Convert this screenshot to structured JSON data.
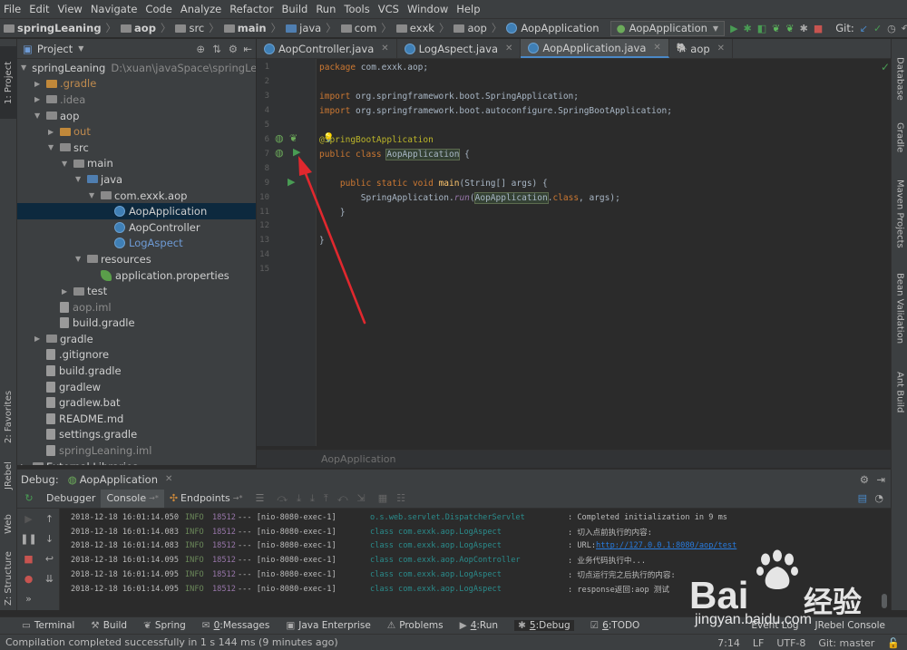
{
  "menu": [
    "File",
    "Edit",
    "View",
    "Navigate",
    "Code",
    "Analyze",
    "Refactor",
    "Build",
    "Run",
    "Tools",
    "VCS",
    "Window",
    "Help"
  ],
  "nav": {
    "crumbs": [
      "springLeaning",
      "aop",
      "src",
      "main",
      "java",
      "com",
      "exxk",
      "aop",
      "AopApplication"
    ],
    "run_config": "AopApplication",
    "git_label": "Git:"
  },
  "left_strip": {
    "project": "1: Project",
    "favorites": "2: Favorites",
    "jrebel": "JRebel",
    "web": "Web",
    "structure": "Z: Structure"
  },
  "right_strip": {
    "database": "Database",
    "gradle": "Gradle",
    "maven": "Maven Projects",
    "bean": "Bean Validation",
    "ant": "Ant Build"
  },
  "project": {
    "title": "Project",
    "tree": [
      {
        "label": "springLeaning",
        "hint": "D:\\xuan\\javaSpace\\springLeaning",
        "depth": 0,
        "arrow": "▼",
        "style": "normal",
        "icon": "folder"
      },
      {
        "label": ".gradle",
        "depth": 1,
        "arrow": "▶",
        "style": "orange",
        "icon": "folder-orange"
      },
      {
        "label": ".idea",
        "depth": 1,
        "arrow": "▶",
        "style": "gray",
        "icon": "folder"
      },
      {
        "label": "aop",
        "depth": 1,
        "arrow": "▼",
        "style": "normal",
        "icon": "folder"
      },
      {
        "label": "out",
        "depth": 2,
        "arrow": "▶",
        "style": "orange",
        "icon": "folder-orange"
      },
      {
        "label": "src",
        "depth": 2,
        "arrow": "▼",
        "style": "normal",
        "icon": "folder"
      },
      {
        "label": "main",
        "depth": 3,
        "arrow": "▼",
        "style": "normal",
        "icon": "folder"
      },
      {
        "label": "java",
        "depth": 4,
        "arrow": "▼",
        "style": "normal",
        "icon": "folder-blue"
      },
      {
        "label": "com.exxk.aop",
        "depth": 5,
        "arrow": "▼",
        "style": "normal",
        "icon": "folder"
      },
      {
        "label": "AopApplication",
        "depth": 6,
        "arrow": "",
        "style": "normal",
        "icon": "class",
        "selected": true
      },
      {
        "label": "AopController",
        "depth": 6,
        "arrow": "",
        "style": "normal",
        "icon": "class"
      },
      {
        "label": "LogAspect",
        "depth": 6,
        "arrow": "",
        "style": "blue",
        "icon": "class"
      },
      {
        "label": "resources",
        "depth": 4,
        "arrow": "▼",
        "style": "normal",
        "icon": "folder"
      },
      {
        "label": "application.properties",
        "depth": 5,
        "arrow": "",
        "style": "normal",
        "icon": "leaf"
      },
      {
        "label": "test",
        "depth": 3,
        "arrow": "▶",
        "style": "normal",
        "icon": "folder"
      },
      {
        "label": "aop.iml",
        "depth": 2,
        "arrow": "",
        "style": "gray",
        "icon": "file"
      },
      {
        "label": "build.gradle",
        "depth": 2,
        "arrow": "",
        "style": "normal",
        "icon": "file"
      },
      {
        "label": "gradle",
        "depth": 1,
        "arrow": "▶",
        "style": "normal",
        "icon": "folder"
      },
      {
        "label": ".gitignore",
        "depth": 1,
        "arrow": "",
        "style": "normal",
        "icon": "file"
      },
      {
        "label": "build.gradle",
        "depth": 1,
        "arrow": "",
        "style": "normal",
        "icon": "file"
      },
      {
        "label": "gradlew",
        "depth": 1,
        "arrow": "",
        "style": "normal",
        "icon": "file"
      },
      {
        "label": "gradlew.bat",
        "depth": 1,
        "arrow": "",
        "style": "normal",
        "icon": "file"
      },
      {
        "label": "README.md",
        "depth": 1,
        "arrow": "",
        "style": "normal",
        "icon": "file"
      },
      {
        "label": "settings.gradle",
        "depth": 1,
        "arrow": "",
        "style": "normal",
        "icon": "file"
      },
      {
        "label": "springLeaning.iml",
        "depth": 1,
        "arrow": "",
        "style": "gray",
        "icon": "file"
      },
      {
        "label": "External Libraries",
        "depth": 0,
        "arrow": "▶",
        "style": "normal",
        "icon": "folder"
      }
    ]
  },
  "editor": {
    "tabs": [
      {
        "label": "AopController.java",
        "active": false
      },
      {
        "label": "LogAspect.java",
        "active": false
      },
      {
        "label": "AopApplication.java",
        "active": true
      },
      {
        "label": "aop",
        "active": false
      }
    ],
    "lines": [
      {
        "n": "1",
        "html": "<span class='kw'>package</span> com.exxk.aop;"
      },
      {
        "n": "2",
        "html": ""
      },
      {
        "n": "3",
        "html": "<span class='kw'>import</span> org.springframework.boot.SpringApplication;"
      },
      {
        "n": "4",
        "html": "<span class='kw'>import</span> org.springframework.boot.autoconfigure.SpringBootApplication;"
      },
      {
        "n": "5",
        "html": ""
      },
      {
        "n": "6",
        "html": "<span class='an'>@SpringBootApplication</span>"
      },
      {
        "n": "7",
        "html": "<span class='kw'>public class</span> <span class='hl'>AopApplication</span> {"
      },
      {
        "n": "8",
        "html": ""
      },
      {
        "n": "9",
        "html": "    <span class='kw'>public static void</span> <span class='fn'>main</span>(String[] args) {"
      },
      {
        "n": "10",
        "html": "        SpringApplication.<span class='st'>run</span>(<span class='hl'>AopApplication</span>.<span class='kw'>class</span>, args);"
      },
      {
        "n": "11",
        "html": "    }"
      },
      {
        "n": "12",
        "html": ""
      },
      {
        "n": "13",
        "html": "}"
      },
      {
        "n": "14",
        "html": ""
      },
      {
        "n": "15",
        "html": ""
      }
    ],
    "bottom_breadcrumb": "AopApplication"
  },
  "debug": {
    "title": "Debug:",
    "config": "AopApplication",
    "tabs": [
      "Debugger",
      "Console",
      "Endpoints"
    ],
    "logs": [
      {
        "ts": "2018-12-18 16:01:14.050",
        "lvl": "INFO",
        "pid": "18512",
        "thr": "--- [nio-8080-exec-1]",
        "cls": "o.s.web.servlet.DispatcherServlet",
        "msg": ": Completed initialization in 9 ms",
        "url": ""
      },
      {
        "ts": "2018-12-18 16:01:14.083",
        "lvl": "INFO",
        "pid": "18512",
        "thr": "--- [nio-8080-exec-1]",
        "cls": "class com.exxk.aop.LogAspect",
        "msg": ": 切入点前执行的内容:",
        "url": ""
      },
      {
        "ts": "2018-12-18 16:01:14.083",
        "lvl": "INFO",
        "pid": "18512",
        "thr": "--- [nio-8080-exec-1]",
        "cls": "class com.exxk.aop.LogAspect",
        "msg": ": URL:",
        "url": "http://127.0.0.1:8080/aop/test"
      },
      {
        "ts": "2018-12-18 16:01:14.095",
        "lvl": "INFO",
        "pid": "18512",
        "thr": "--- [nio-8080-exec-1]",
        "cls": "class com.exxk.aop.AopController",
        "msg": ": 业务代码执行中...",
        "url": ""
      },
      {
        "ts": "2018-12-18 16:01:14.095",
        "lvl": "INFO",
        "pid": "18512",
        "thr": "--- [nio-8080-exec-1]",
        "cls": "class com.exxk.aop.LogAspect",
        "msg": ": 切点运行完之后执行的内容:",
        "url": ""
      },
      {
        "ts": "2018-12-18 16:01:14.095",
        "lvl": "INFO",
        "pid": "18512",
        "thr": "--- [nio-8080-exec-1]",
        "cls": "class com.exxk.aop.LogAspect",
        "msg": ": response返回:aop 测试",
        "url": ""
      }
    ]
  },
  "bottom_tools": [
    {
      "label": "Terminal",
      "num": ""
    },
    {
      "label": "Build",
      "num": ""
    },
    {
      "label": "Spring",
      "num": ""
    },
    {
      "label": "Messages",
      "num": "0"
    },
    {
      "label": "Java Enterprise",
      "num": ""
    },
    {
      "label": "Problems",
      "num": ""
    },
    {
      "label": "Run",
      "num": "4"
    },
    {
      "label": "Debug",
      "num": "5",
      "active": true
    },
    {
      "label": "TODO",
      "num": "6"
    }
  ],
  "bottom_right": {
    "event_log": "Event Log",
    "jrebel_console": "JRebel Console"
  },
  "status": {
    "message": "Compilation completed successfully in 1 s 144 ms (9 minutes ago)",
    "position": "7:14",
    "line_sep": "LF",
    "encoding": "UTF-8",
    "git": "Git: master"
  },
  "watermark": {
    "brand": "Bai",
    "brand_cn": "经验",
    "url": "jingyan.baidu.com"
  },
  "colors": {
    "accent": "#4a88c7",
    "arrow": "#e0282e",
    "run": "#499c54"
  }
}
